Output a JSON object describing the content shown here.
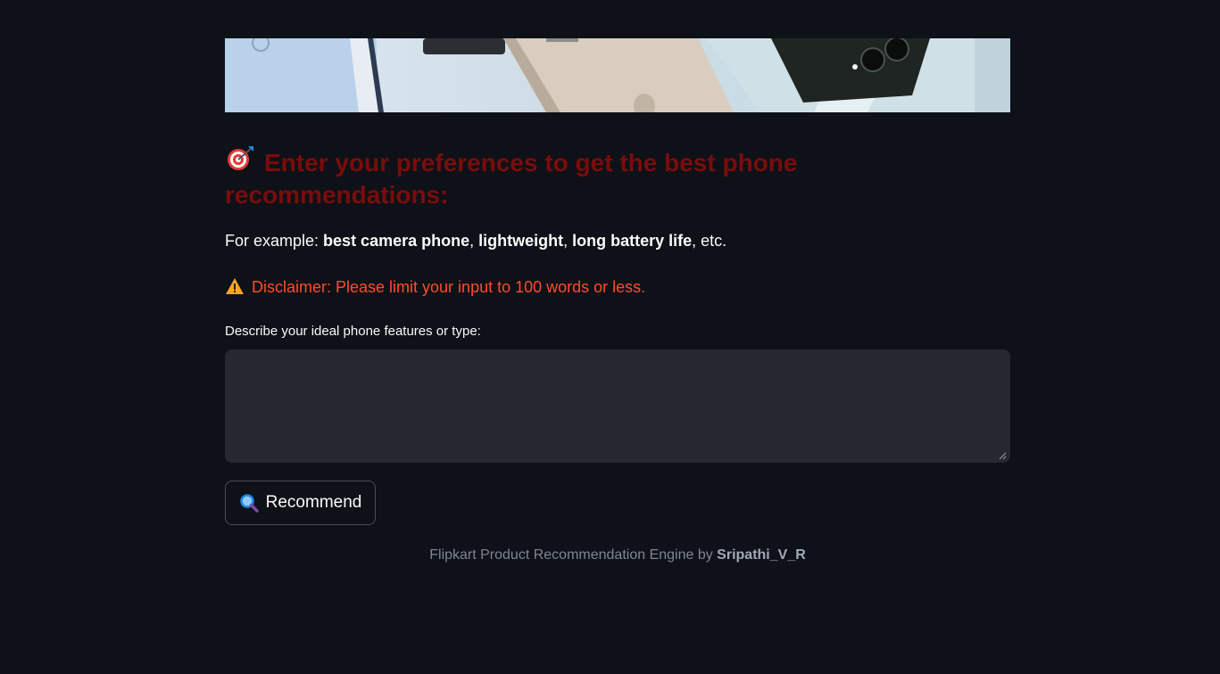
{
  "banner": {
    "alt": "phones banner image"
  },
  "heading": {
    "icon": "target-icon",
    "text": "Enter your preferences to get the best phone recommendations:"
  },
  "example": {
    "prefix": "For example: ",
    "items": [
      "best camera phone",
      "lightweight",
      "long battery life"
    ],
    "suffix": ", etc."
  },
  "disclaimer": {
    "icon": "warning-icon",
    "text": "Disclaimer: Please limit your input to 100 words or less."
  },
  "input": {
    "label": "Describe your ideal phone features or type:",
    "value": "",
    "placeholder": ""
  },
  "button": {
    "icon": "magnifier-icon",
    "label": "Recommend"
  },
  "footer": {
    "prefix": "Flipkart Product Recommendation Engine by ",
    "author": "Sripathi_V_R"
  },
  "colors": {
    "background": "#0e1117",
    "heading": "#7a0c0c",
    "disclaimer": "#ff4b2b",
    "input_bg": "#262730"
  }
}
